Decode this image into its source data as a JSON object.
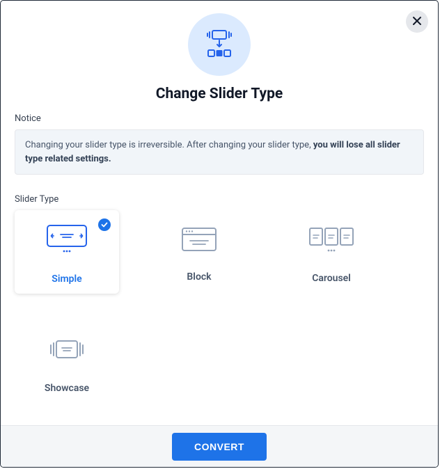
{
  "title": "Change Slider Type",
  "notice": {
    "label": "Notice",
    "text_prefix": "Changing your slider type is irreversible. After changing your slider type, ",
    "text_bold": "you will lose all slider type related settings."
  },
  "slider_type": {
    "label": "Slider Type",
    "options": [
      {
        "label": "Simple",
        "selected": true
      },
      {
        "label": "Block",
        "selected": false
      },
      {
        "label": "Carousel",
        "selected": false
      },
      {
        "label": "Showcase",
        "selected": false
      }
    ]
  },
  "footer": {
    "convert_label": "CONVERT"
  }
}
